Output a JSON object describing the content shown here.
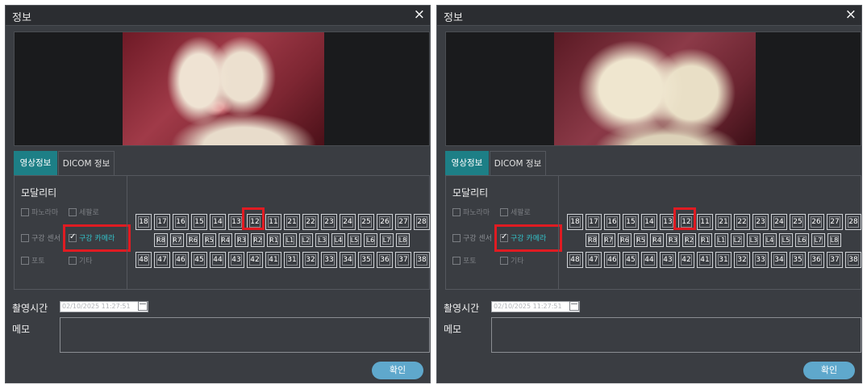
{
  "dialogs": [
    {
      "title": "정보",
      "close_label": "×",
      "tabs": [
        "영상정보",
        "DICOM 정보"
      ],
      "modality_title": "모달리티",
      "modalities": [
        {
          "label": "파노라마",
          "checked": false
        },
        {
          "label": "세팔로",
          "checked": false
        },
        {
          "label": "구강 센서",
          "checked": false
        },
        {
          "label": "구강 카메라",
          "checked": true
        },
        {
          "label": "포토",
          "checked": false
        },
        {
          "label": "기타",
          "checked": false
        }
      ],
      "teeth_upper": [
        "18",
        "17",
        "16",
        "15",
        "14",
        "13",
        "12",
        "11",
        "21",
        "22",
        "23",
        "24",
        "25",
        "26",
        "27",
        "28"
      ],
      "teeth_baby": [
        "R8",
        "R7",
        "R6",
        "R5",
        "R4",
        "R3",
        "R2",
        "R1",
        "L1",
        "L2",
        "L3",
        "L4",
        "L5",
        "L6",
        "L7",
        "L8"
      ],
      "teeth_lower": [
        "48",
        "47",
        "46",
        "45",
        "44",
        "43",
        "42",
        "41",
        "31",
        "32",
        "33",
        "34",
        "35",
        "36",
        "37",
        "38"
      ],
      "selected_tooth": "12",
      "capture_time_label": "촬영시간",
      "capture_time_value": "02/10/2025 11:27:51",
      "memo_label": "메모",
      "memo_value": "",
      "ok_label": "확인"
    },
    {
      "title": "정보",
      "close_label": "×",
      "tabs": [
        "영상정보",
        "DICOM 정보"
      ],
      "modality_title": "모달리티",
      "modalities": [
        {
          "label": "파노라마",
          "checked": false
        },
        {
          "label": "세팔로",
          "checked": false
        },
        {
          "label": "구강 센서",
          "checked": false
        },
        {
          "label": "구강 카메라",
          "checked": true
        },
        {
          "label": "포토",
          "checked": false
        },
        {
          "label": "기타",
          "checked": false
        }
      ],
      "teeth_upper": [
        "18",
        "17",
        "16",
        "15",
        "14",
        "13",
        "12",
        "11",
        "21",
        "22",
        "23",
        "24",
        "25",
        "26",
        "27",
        "28"
      ],
      "teeth_baby": [
        "R8",
        "R7",
        "R6",
        "R5",
        "R4",
        "R3",
        "R2",
        "R1",
        "L1",
        "L2",
        "L3",
        "L4",
        "L5",
        "L6",
        "L7",
        "L8"
      ],
      "teeth_lower": [
        "48",
        "47",
        "46",
        "45",
        "44",
        "43",
        "42",
        "41",
        "31",
        "32",
        "33",
        "34",
        "35",
        "36",
        "37",
        "38"
      ],
      "selected_tooth": "12",
      "capture_time_label": "촬영시간",
      "capture_time_value": "02/10/2025 11:27:51",
      "memo_label": "메모",
      "memo_value": "",
      "ok_label": "확인"
    }
  ],
  "colors": {
    "dialog_bg": "#3a3d42",
    "titlebar_bg": "#2b2d31",
    "tab_active_bg": "#1d7f86",
    "checked_text": "#33c2c9",
    "highlight_red": "#e01b22",
    "ok_button": "#5fa8cc"
  },
  "icons": {
    "close": "close-icon",
    "calendar": "calendar-icon",
    "checkbox": "checkbox-icon"
  }
}
